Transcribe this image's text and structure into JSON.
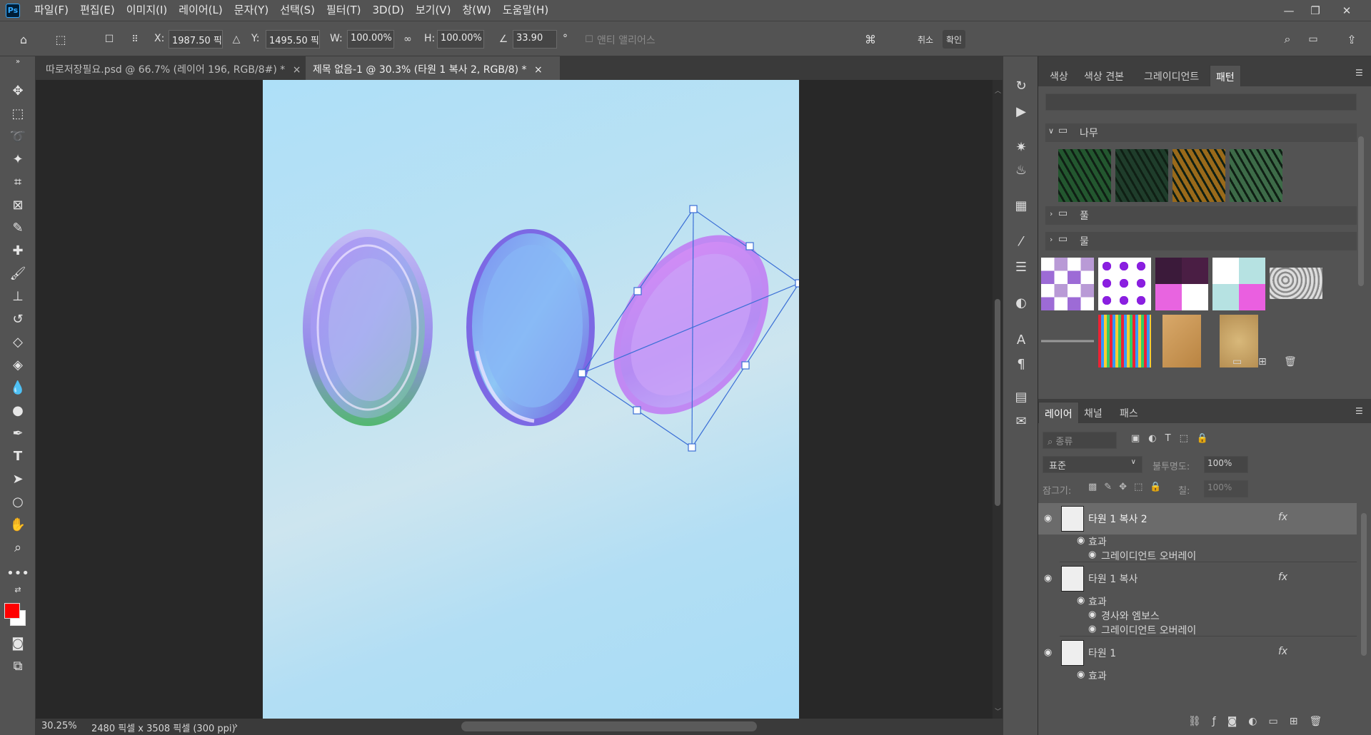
{
  "app": {
    "logo": "Ps"
  },
  "menu": [
    "파일(F)",
    "편집(E)",
    "이미지(I)",
    "레이어(L)",
    "문자(Y)",
    "선택(S)",
    "필터(T)",
    "3D(D)",
    "보기(V)",
    "창(W)",
    "도움말(H)"
  ],
  "window_controls": {
    "minimize": "—",
    "restore": "❐",
    "close": "✕"
  },
  "options": {
    "x_label": "X:",
    "x_value": "1987.50 픽셀",
    "y_label": "Y:",
    "y_value": "1495.50 픽셀",
    "w_label": "W:",
    "w_value": "100.00%",
    "h_label": "H:",
    "h_value": "100.00%",
    "angle_value": "33.90",
    "degree": "°",
    "antialias_label": "앤티 앨리어스",
    "cancel_label": "취소",
    "confirm_label": "확인"
  },
  "tabs": [
    {
      "label": "따로저장필요.psd @ 66.7% (레이어 196, RGB/8#) *",
      "close": "×",
      "active": false
    },
    {
      "label": "제목 없음-1 @ 30.3% (타원 1 복사 2, RGB/8) *",
      "close": "×",
      "active": true
    }
  ],
  "status": {
    "zoom": "30.25%",
    "info": "2480 픽셀 x 3508 픽셀 (300 ppi)",
    "arrow": "›"
  },
  "colors": {
    "foreground": "#ff0000",
    "background": "#ffffff",
    "selection": "#3b6fd6"
  },
  "patterns_panel": {
    "tabs": [
      "색상",
      "색상 견본",
      "그레이디언트",
      "패턴"
    ],
    "active_tab": "패턴",
    "groups": [
      {
        "name": "나무",
        "expanded": true,
        "items": [
          "#23572f",
          "#1f3d2b",
          "#9a6a1a",
          "#3d6b48"
        ]
      },
      {
        "name": "풀",
        "expanded": false
      },
      {
        "name": "물",
        "expanded": false
      }
    ],
    "pattern_rows": [
      [
        "checker-lavender",
        "diamond-purple",
        "checker-plum",
        "checker-mint",
        "noise-gray"
      ],
      [
        "dotted-line",
        "plaid",
        "paper-tan",
        "sand"
      ]
    ]
  },
  "layers_panel": {
    "tabs": [
      "레이어",
      "채널",
      "패스"
    ],
    "active_tab": "레이어",
    "filter_placeholder": "종류",
    "blend_mode": "표준",
    "opacity_label": "불투명도:",
    "opacity_value": "100%",
    "lock_label": "잠그기:",
    "fill_label": "칠:",
    "fill_value": "100%",
    "layers": [
      {
        "name": "타원 1 복사 2",
        "selected": true,
        "fx": "fx",
        "effects_label": "효과",
        "effects": [
          "그레이디언트 오버레이"
        ]
      },
      {
        "name": "타원 1 복사",
        "selected": false,
        "fx": "fx",
        "effects_label": "효과",
        "effects": [
          "경사와 엠보스",
          "그레이디언트 오버레이"
        ]
      },
      {
        "name": "타원 1",
        "selected": false,
        "fx": "fx",
        "effects_label": "효과",
        "effects": []
      }
    ]
  }
}
